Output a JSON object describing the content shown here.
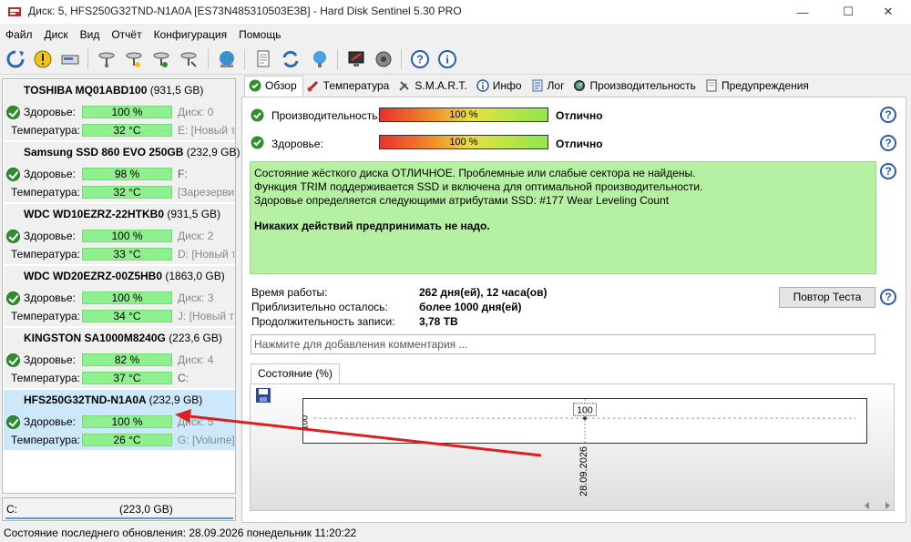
{
  "window": {
    "title": "Диск: 5, HFS250G32TND-N1A0A [ES73N485310503E3B]  -  Hard Disk Sentinel 5.30 PRO",
    "minimize": "—",
    "maximize": "☐",
    "close": "✕"
  },
  "menu": [
    "Файл",
    "Диск",
    "Вид",
    "Отчёт",
    "Конфигурация",
    "Помощь"
  ],
  "toolbar": {
    "icons": [
      "refresh-icon",
      "alert-icon",
      "disk-icon",
      "probe-icon",
      "probe-warning-icon",
      "probe-ok-icon",
      "probe-tool-icon",
      "globe-icon",
      "report-icon",
      "sync-icon",
      "network-icon",
      "monitor-icon",
      "speaker-icon",
      "help-icon",
      "info-icon"
    ]
  },
  "disks": [
    {
      "name": "TOSHIBA MQ01ABD100",
      "size": "(931,5 GB)",
      "health_label": "Здоровье:",
      "health": "100 %",
      "temp_label": "Температура:",
      "temp": "32 °C",
      "disk_no": "Диск: 0",
      "volume": "E: [Новый т"
    },
    {
      "name": "Samsung SSD 860 EVO 250GB",
      "size": "(232,9 GB)",
      "health_label": "Здоровье:",
      "health": "98 %",
      "temp_label": "Температура:",
      "temp": "32 °C",
      "disk_no": "F:",
      "volume": "[Зарезервир"
    },
    {
      "name": "WDC WD10EZRZ-22HTKB0",
      "size": "(931,5 GB)",
      "health_label": "Здоровье:",
      "health": "100 %",
      "temp_label": "Температура:",
      "temp": "33 °C",
      "disk_no": "Диск: 2",
      "volume": "D: [Новый т"
    },
    {
      "name": "WDC WD20EZRZ-00Z5HB0",
      "size": "(1863,0 GB)",
      "health_label": "Здоровье:",
      "health": "100 %",
      "temp_label": "Температура:",
      "temp": "34 °C",
      "disk_no": "Диск: 3",
      "volume": "J: [Новый т"
    },
    {
      "name": "KINGSTON SA1000M8240G",
      "size": "(223,6 GB)",
      "health_label": "Здоровье:",
      "health": "82 %",
      "temp_label": "Температура:",
      "temp": "37 °C",
      "disk_no": "Диск: 4",
      "volume": "C:"
    },
    {
      "name": "HFS250G32TND-N1A0A",
      "size": "(232,9 GB)",
      "health_label": "Здоровье:",
      "health": "100 %",
      "temp_label": "Температура:",
      "temp": "26 °C",
      "disk_no": "Диск: 5",
      "volume": "G: [Volume]"
    }
  ],
  "left_bottom": {
    "drive": "C:",
    "size": "(223,0 GB)"
  },
  "status_bar": "Состояние последнего обновления: 28.09.2026 понедельник 11:20:22",
  "tabs": [
    {
      "label": "Обзор",
      "icon": "check-icon"
    },
    {
      "label": "Температура",
      "icon": "thermometer-icon"
    },
    {
      "label": "S.M.A.R.T.",
      "icon": "tools-icon"
    },
    {
      "label": "Инфо",
      "icon": "info-icon"
    },
    {
      "label": "Лог",
      "icon": "log-icon"
    },
    {
      "label": "Производительность",
      "icon": "gauge-icon"
    },
    {
      "label": "Предупреждения",
      "icon": "warning-page-icon"
    }
  ],
  "overview": {
    "performance_label": "Производительность:",
    "performance_value": "100 %",
    "performance_status": "Отлично",
    "health_label": "Здоровье:",
    "health_value": "100 %",
    "health_status": "Отлично",
    "info_lines": [
      "Состояние жёсткого диска ОТЛИЧНОЕ. Проблемные или слабые сектора не найдены.",
      "Функция TRIM поддерживается SSD и включена для оптимальной производительности.",
      "Здоровье определяется следующими атрибутами SSD: #177 Wear Leveling Count"
    ],
    "info_bold": "Никаких действий предпринимать не надо.",
    "uptime_label": "Время работы:",
    "uptime_value": "262 дня(ей), 12 часа(ов)",
    "remaining_label": "Приблизительно осталось:",
    "remaining_value": "более 1000 дня(ей)",
    "writes_label": "Продолжительность записи:",
    "writes_value": "3,78 TB",
    "retest_button": "Повтор Теста",
    "comment_placeholder": "Нажмите для добавления комментария ..."
  },
  "chart_tab": "Состояние (%)",
  "chart_data": {
    "type": "line",
    "x": [
      "28.09.2026"
    ],
    "series": [
      {
        "values": [
          100
        ]
      }
    ],
    "data_labels": [
      "100"
    ],
    "y_tick": "100",
    "ylim": [
      0,
      100
    ]
  },
  "colors": {
    "selected_disk": "#cce8fa",
    "health_bar": "#8ef08e",
    "info_box": "#b6f0a3",
    "annotation_arrow": "#dd1f1f"
  }
}
